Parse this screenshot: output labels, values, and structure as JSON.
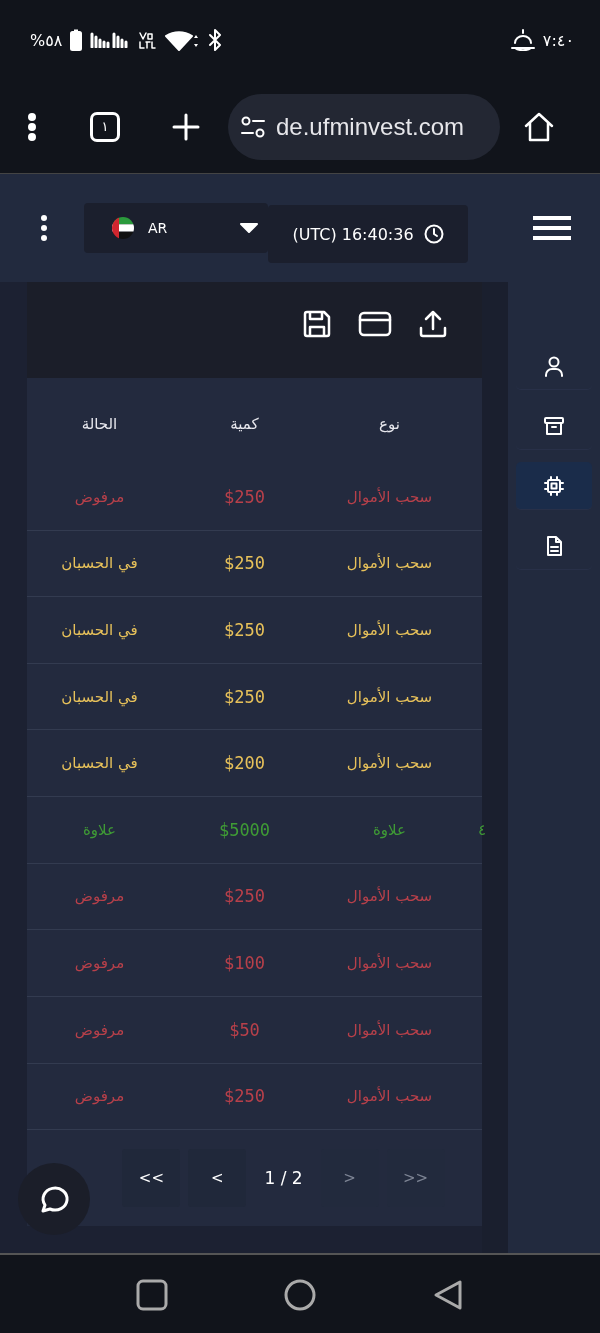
{
  "status_bar": {
    "time": "٧:٤٠",
    "battery": "%٥٨"
  },
  "browser": {
    "tab_count": "١",
    "url": "de.ufminvest.com"
  },
  "header": {
    "language": "AR",
    "clock": "(UTC) 16:40:36"
  },
  "sidebar": {
    "items": [
      {
        "kind": "user",
        "selected": false
      },
      {
        "kind": "archive",
        "selected": false
      },
      {
        "kind": "chip",
        "selected": true
      },
      {
        "kind": "document",
        "selected": false
      }
    ]
  },
  "table": {
    "columns": [
      "نوع",
      "كمية",
      "الحالة"
    ],
    "rows": [
      {
        "kind": "rejected",
        "type": "سحب الأموال",
        "amount": "$250",
        "status": "مرفوض"
      },
      {
        "kind": "pending",
        "type": "سحب الأموال",
        "amount": "$250",
        "status": "في الحسبان"
      },
      {
        "kind": "pending",
        "type": "سحب الأموال",
        "amount": "$250",
        "status": "في الحسبان"
      },
      {
        "kind": "pending",
        "type": "سحب الأموال",
        "amount": "$250",
        "status": "في الحسبان"
      },
      {
        "kind": "pending",
        "type": "سحب الأموال",
        "amount": "$200",
        "status": "في الحسبان"
      },
      {
        "kind": "bonus",
        "type": "علاوة",
        "amount": "$5000",
        "status": "علاوة",
        "column_4": "٤"
      },
      {
        "kind": "rejected",
        "type": "سحب الأموال",
        "amount": "$250",
        "status": "مرفوض"
      },
      {
        "kind": "rejected",
        "type": "سحب الأموال",
        "amount": "$100",
        "status": "مرفوض"
      },
      {
        "kind": "rejected",
        "type": "سحب الأموال",
        "amount": "$50",
        "status": "مرفوض"
      },
      {
        "kind": "rejected",
        "type": "سحب الأموال",
        "amount": "$250",
        "status": "مرفوض"
      }
    ]
  },
  "pagination": {
    "first": {
      "label": "<<",
      "disabled": false
    },
    "prev": {
      "label": "<",
      "disabled": false
    },
    "page": "1 / 2",
    "next": {
      "label": ">",
      "disabled": true
    },
    "last": {
      "label": ">>",
      "disabled": true
    }
  }
}
